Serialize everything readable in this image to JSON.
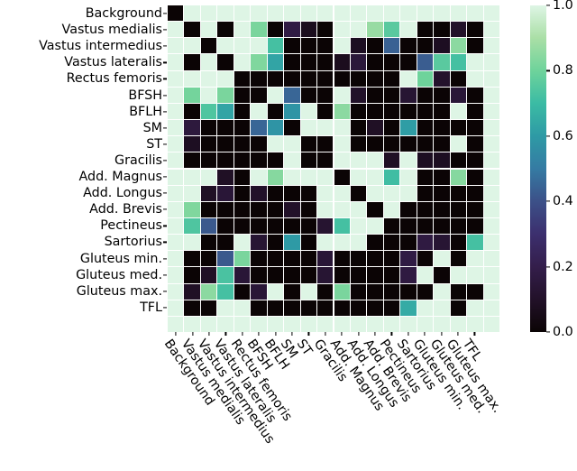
{
  "chart_data": {
    "type": "heatmap",
    "title": "",
    "xlabel": "",
    "ylabel": "",
    "grid": false,
    "legend_position": "right",
    "colormap": "mako",
    "colorbar": {
      "min": 0.0,
      "max": 1.0,
      "ticks": [
        0.0,
        0.2,
        0.4,
        0.6,
        0.8,
        1.0
      ],
      "tick_labels": [
        "0.0",
        "0.2",
        "0.4",
        "0.6",
        "0.8",
        "1.0"
      ],
      "stops": [
        {
          "t": 0.0,
          "hex": "#0b0405"
        },
        {
          "t": 0.1,
          "hex": "#221129"
        },
        {
          "t": 0.2,
          "hex": "#341e4b"
        },
        {
          "t": 0.3,
          "hex": "#3c2f6e"
        },
        {
          "t": 0.4,
          "hex": "#3c5088"
        },
        {
          "t": 0.5,
          "hex": "#357ba3"
        },
        {
          "t": 0.6,
          "hex": "#2e9aa5"
        },
        {
          "t": 0.7,
          "hex": "#3bbba4"
        },
        {
          "t": 0.8,
          "hex": "#6ed39b"
        },
        {
          "t": 0.9,
          "hex": "#aadfa6"
        },
        {
          "t": 1.0,
          "hex": "#def5e5"
        }
      ]
    },
    "categories": [
      "Background",
      "Vastus medialis",
      "Vastus intermedius",
      "Vastus lateralis",
      "Rectus femoris",
      "BFSH",
      "BFLH",
      "SM",
      "ST",
      "Gracilis",
      "Add. Magnus",
      "Add. Longus",
      "Add. Brevis",
      "Pectineus",
      "Sartorius",
      "Gluteus min.",
      "Gluteus med.",
      "Gluteus max.",
      "TFL"
    ],
    "ylabels": [
      "Background",
      "Vastus medialis",
      "Vastus intermedius",
      "Vastus lateralis",
      "Rectus femoris",
      "BFSH",
      "BFLH",
      "SM",
      "ST",
      "Gracilis",
      "Add. Magnus",
      "Add. Longus",
      "Add. Brevis",
      "Pectineus",
      "Sartorius",
      "Gluteus min.",
      "Gluteus med.",
      "Gluteus max.",
      "TFL"
    ],
    "xlabels": [
      "Background",
      "Vastus medialis",
      "Vastus intermedius",
      "Vastus lateralis",
      "Rectus femoris",
      "BFSH",
      "BFLH",
      "SM",
      "ST",
      "Gracilis",
      "Add. Magnus",
      "Add. Longus",
      "Add. Brevis",
      "Pectineus",
      "Sartorius",
      "Gluteus min.",
      "Gluteus med.",
      "Gluteus max.",
      "TFL"
    ],
    "n_rows": 20,
    "n_cols": 20,
    "values": [
      [
        0.0,
        1.0,
        1.0,
        1.0,
        1.0,
        1.0,
        1.0,
        1.0,
        1.0,
        1.0,
        1.0,
        1.0,
        1.0,
        1.0,
        1.0,
        1.0,
        1.0,
        1.0,
        1.0,
        1.0
      ],
      [
        1.0,
        0.0,
        1.0,
        0.0,
        1.0,
        0.82,
        0.0,
        0.18,
        0.07,
        0.0,
        1.0,
        1.0,
        0.87,
        0.76,
        1.0,
        0.0,
        0.0,
        0.1,
        0.0,
        1.0
      ],
      [
        1.0,
        1.0,
        0.0,
        1.0,
        1.0,
        1.0,
        0.72,
        0.0,
        0.0,
        0.0,
        1.0,
        0.08,
        0.0,
        0.44,
        0.0,
        0.0,
        0.08,
        0.85,
        0.0,
        1.0
      ],
      [
        1.0,
        0.0,
        1.0,
        0.0,
        1.0,
        0.83,
        0.63,
        0.0,
        0.0,
        0.0,
        0.07,
        0.15,
        0.0,
        0.0,
        0.0,
        0.43,
        0.76,
        0.72,
        1.0,
        1.0
      ],
      [
        1.0,
        1.0,
        1.0,
        1.0,
        0.0,
        0.0,
        0.0,
        0.0,
        0.0,
        0.0,
        0.0,
        0.0,
        0.0,
        0.0,
        1.0,
        0.8,
        0.11,
        0.0,
        1.0,
        1.0
      ],
      [
        1.0,
        0.81,
        1.0,
        0.82,
        0.0,
        0.0,
        1.0,
        0.45,
        0.0,
        0.0,
        1.0,
        0.1,
        0.0,
        0.0,
        0.13,
        0.0,
        0.0,
        0.14,
        0.0,
        1.0
      ],
      [
        1.0,
        0.0,
        0.74,
        0.63,
        0.0,
        1.0,
        0.0,
        0.58,
        1.0,
        0.0,
        0.85,
        0.0,
        0.0,
        0.0,
        0.0,
        0.0,
        0.0,
        1.0,
        0.0,
        1.0
      ],
      [
        1.0,
        0.16,
        0.0,
        0.0,
        0.0,
        0.45,
        0.58,
        0.0,
        1.0,
        1.0,
        1.0,
        0.0,
        0.09,
        0.0,
        0.61,
        0.0,
        0.0,
        0.0,
        0.0,
        1.0
      ],
      [
        1.0,
        0.08,
        0.0,
        0.0,
        0.0,
        0.0,
        1.0,
        1.0,
        0.0,
        0.0,
        1.0,
        0.0,
        0.0,
        0.0,
        0.0,
        0.0,
        0.0,
        1.0,
        0.0,
        1.0
      ],
      [
        1.0,
        0.0,
        0.0,
        0.0,
        0.0,
        0.0,
        0.0,
        1.0,
        0.0,
        0.0,
        1.0,
        1.0,
        1.0,
        0.09,
        1.0,
        0.08,
        0.08,
        0.0,
        0.0,
        1.0
      ],
      [
        1.0,
        1.0,
        1.0,
        0.09,
        0.0,
        1.0,
        0.84,
        1.0,
        1.0,
        1.0,
        0.0,
        1.0,
        1.0,
        0.71,
        1.0,
        0.0,
        0.0,
        0.84,
        0.0,
        1.0
      ],
      [
        1.0,
        1.0,
        0.09,
        0.14,
        0.0,
        0.1,
        0.0,
        0.0,
        0.0,
        1.0,
        1.0,
        0.0,
        1.0,
        1.0,
        1.0,
        0.0,
        0.0,
        0.0,
        0.0,
        1.0
      ],
      [
        1.0,
        0.83,
        0.0,
        0.0,
        0.0,
        0.0,
        0.0,
        0.1,
        0.0,
        1.0,
        1.0,
        1.0,
        0.0,
        1.0,
        0.0,
        0.0,
        0.0,
        0.0,
        0.0,
        1.0
      ],
      [
        1.0,
        0.74,
        0.42,
        0.0,
        0.0,
        0.0,
        0.0,
        0.0,
        0.0,
        0.12,
        0.72,
        1.0,
        1.0,
        0.0,
        0.0,
        0.0,
        0.0,
        0.0,
        0.0,
        1.0
      ],
      [
        1.0,
        1.0,
        0.0,
        0.0,
        1.0,
        0.13,
        0.0,
        0.6,
        0.0,
        1.0,
        1.0,
        1.0,
        0.0,
        0.0,
        0.0,
        0.17,
        0.13,
        0.0,
        0.72,
        1.0
      ],
      [
        1.0,
        0.0,
        0.0,
        0.42,
        0.82,
        0.0,
        0.0,
        0.0,
        0.0,
        0.14,
        0.0,
        0.0,
        0.0,
        0.0,
        0.18,
        0.0,
        1.0,
        0.0,
        1.0,
        1.0
      ],
      [
        1.0,
        0.0,
        0.09,
        0.73,
        0.14,
        0.0,
        0.0,
        0.0,
        0.0,
        0.13,
        0.0,
        0.0,
        0.0,
        0.0,
        0.17,
        1.0,
        0.0,
        1.0,
        1.0,
        1.0
      ],
      [
        1.0,
        0.09,
        0.85,
        0.72,
        0.0,
        0.14,
        1.0,
        0.0,
        1.0,
        0.0,
        0.82,
        0.0,
        0.0,
        0.0,
        0.0,
        0.0,
        1.0,
        0.0,
        0.0,
        1.0
      ],
      [
        1.0,
        0.0,
        0.0,
        1.0,
        1.0,
        0.0,
        0.0,
        0.0,
        0.0,
        0.0,
        0.0,
        0.0,
        0.0,
        0.0,
        0.65,
        1.0,
        1.0,
        0.0,
        1.0,
        1.0
      ],
      [
        1.0,
        1.0,
        1.0,
        1.0,
        1.0,
        1.0,
        1.0,
        1.0,
        1.0,
        1.0,
        1.0,
        1.0,
        1.0,
        1.0,
        1.0,
        1.0,
        1.0,
        1.0,
        1.0,
        1.0
      ]
    ]
  }
}
